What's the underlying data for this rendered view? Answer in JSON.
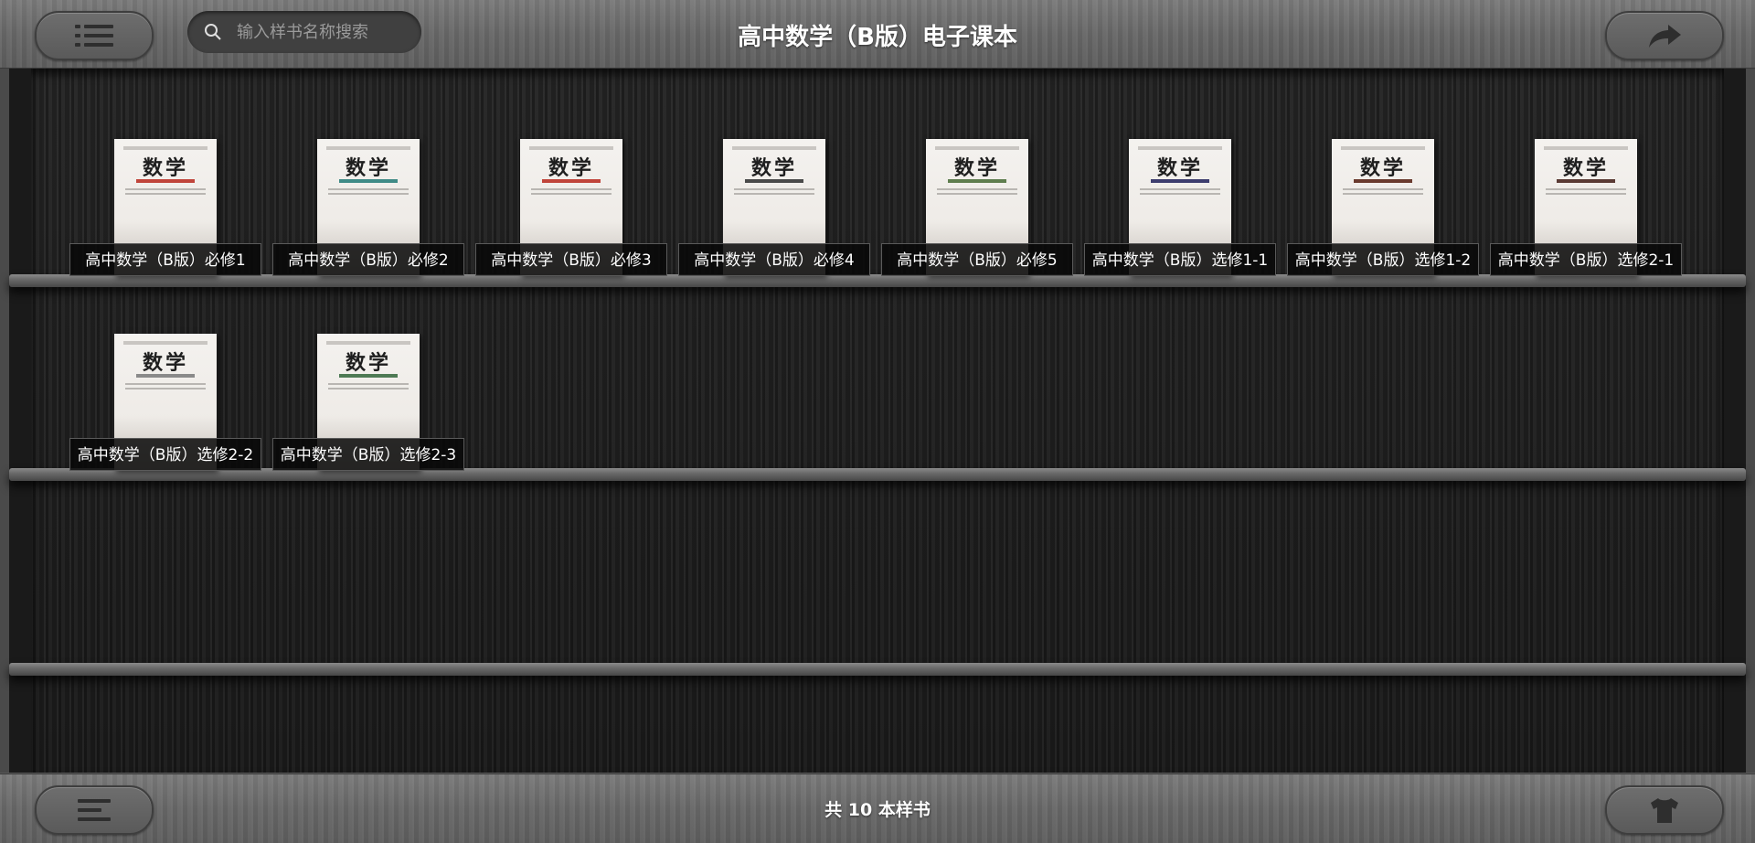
{
  "header": {
    "title": "高中数学（B版）电子课本",
    "search_placeholder": "输入样书名称搜索",
    "menu_icon": "list-icon",
    "share_icon": "share-arrow-icon"
  },
  "footer": {
    "count_text": "共 10 本样书",
    "menu_icon": "align-left-icon",
    "theme_icon": "tshirt-icon"
  },
  "books": [
    {
      "label": "高中数学（B版）必修1",
      "cover": "数学",
      "band_color": "#c0443a"
    },
    {
      "label": "高中数学（B版）必修2",
      "cover": "数学",
      "band_color": "#3f8a86"
    },
    {
      "label": "高中数学（B版）必修3",
      "cover": "数学",
      "band_color": "#c0443a"
    },
    {
      "label": "高中数学（B版）必修4",
      "cover": "数学",
      "band_color": "#4a4a4a"
    },
    {
      "label": "高中数学（B版）必修5",
      "cover": "数学",
      "band_color": "#5e7d4e"
    },
    {
      "label": "高中数学（B版）选修1-1",
      "cover": "数学",
      "band_color": "#3d3d6e"
    },
    {
      "label": "高中数学（B版）选修1-2",
      "cover": "数学",
      "band_color": "#6a3a2e"
    },
    {
      "label": "高中数学（B版）选修2-1",
      "cover": "数学",
      "band_color": "#5a3a34"
    },
    {
      "label": "高中数学（B版）选修2-2",
      "cover": "数学",
      "band_color": "#8a8a8a"
    },
    {
      "label": "高中数学（B版）选修2-3",
      "cover": "数学",
      "band_color": "#4e7a54"
    }
  ]
}
